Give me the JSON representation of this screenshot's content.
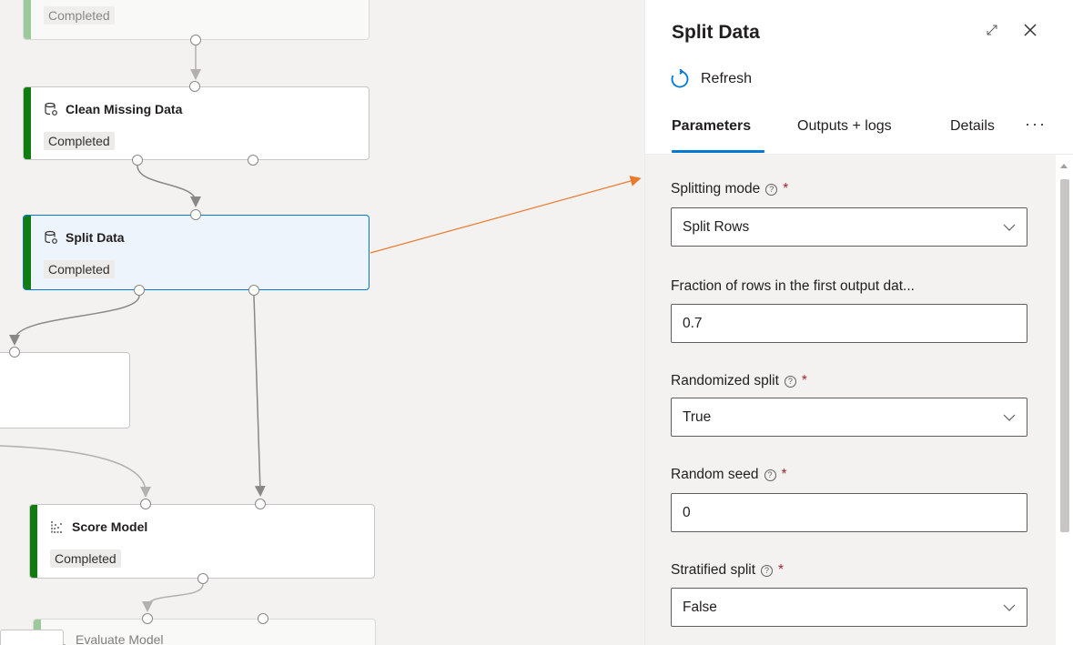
{
  "canvas": {
    "nodes": {
      "top_partial": {
        "status": "Completed"
      },
      "clean_missing": {
        "title": "Clean Missing Data",
        "status": "Completed",
        "icon": "dataset-gear-icon"
      },
      "split_data": {
        "title": "Split Data",
        "status": "Completed",
        "icon": "dataset-gear-icon"
      },
      "score_model": {
        "title": "Score Model",
        "status": "Completed",
        "icon": "scatter-icon"
      },
      "evaluate_model": {
        "title": "Evaluate Model",
        "icon": "scatter-icon"
      }
    },
    "annotation_arrow_color": "#e97b2e",
    "accent": "#107c10"
  },
  "panel": {
    "title": "Split Data",
    "refresh_label": "Refresh",
    "tabs": [
      {
        "label": "Parameters",
        "active": true
      },
      {
        "label": "Outputs + logs",
        "active": false
      },
      {
        "label": "Details",
        "active": false
      }
    ],
    "more_label": "···",
    "fields": {
      "splitting_mode": {
        "label": "Splitting mode",
        "required": "*",
        "value": "Split Rows"
      },
      "fraction": {
        "label": "Fraction of rows in the first output dat...",
        "value": "0.7"
      },
      "randomized_split": {
        "label": "Randomized split",
        "required": "*",
        "value": "True"
      },
      "random_seed": {
        "label": "Random seed",
        "required": "*",
        "value": "0"
      },
      "stratified_split": {
        "label": "Stratified split",
        "required": "*",
        "value": "False"
      }
    },
    "help_glyph": "?",
    "accent": "#0078d4"
  }
}
